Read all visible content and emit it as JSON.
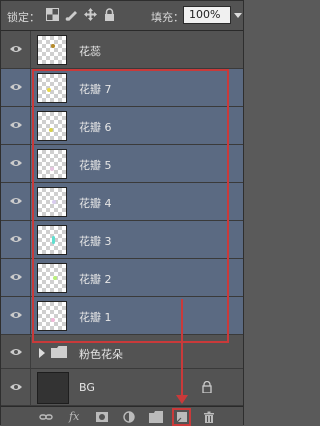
{
  "toolbar": {
    "lock_label": "锁定：",
    "fill_label": "填充：",
    "fill_value": "100%"
  },
  "layers": [
    {
      "name": "花蕊",
      "selected": false,
      "dot_color": "#b58a2a"
    },
    {
      "name": "花瓣 7",
      "selected": true,
      "dot_color": "#e8d84a"
    },
    {
      "name": "花瓣 6",
      "selected": true,
      "dot_color": "#d9d34e"
    },
    {
      "name": "花瓣 5",
      "selected": true,
      "dot_color": "#e7c4e0"
    },
    {
      "name": "花瓣 4",
      "selected": true,
      "dot_color": "#d9ccef"
    },
    {
      "name": "花瓣 3",
      "selected": true,
      "dot_color": "#5fe0d0"
    },
    {
      "name": "花瓣 2",
      "selected": true,
      "dot_color": "#b8f07a"
    },
    {
      "name": "花瓣 1",
      "selected": true,
      "dot_color": "#f0b8d8"
    }
  ],
  "group": {
    "name": "粉色花朵"
  },
  "background_layer": {
    "name": "BG"
  },
  "bottom_toolbar": {
    "fx_label": "fx"
  },
  "colors": {
    "panel_bg": "#535353",
    "selected_row": "#5b6a82",
    "highlight_red": "#c93a3a"
  }
}
